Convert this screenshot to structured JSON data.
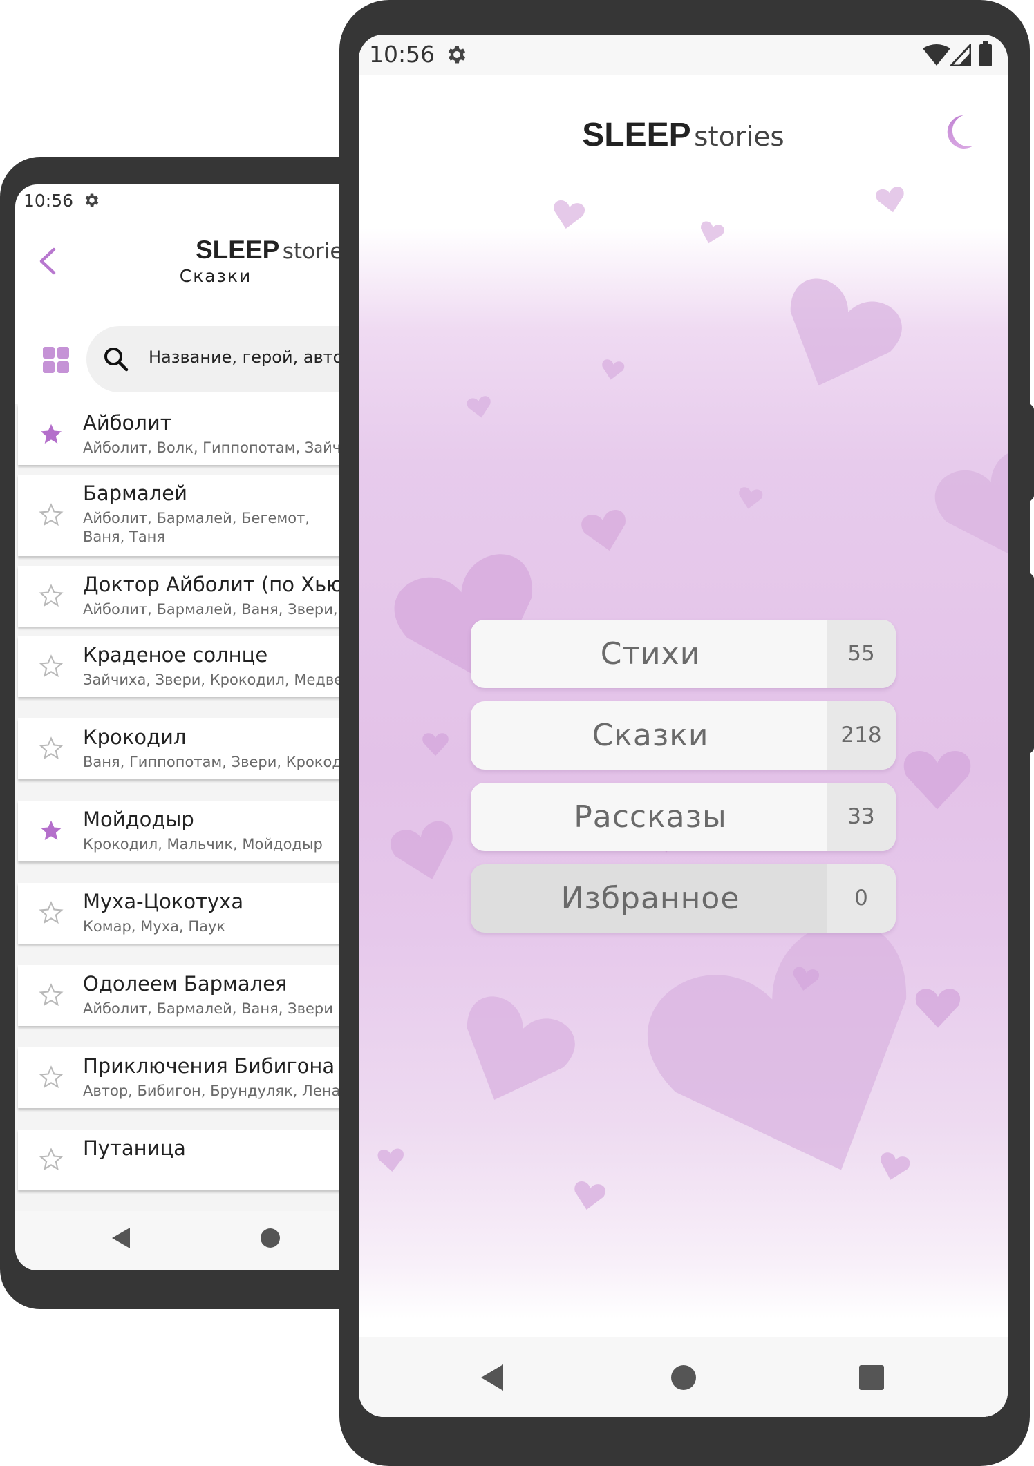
{
  "back_phone": {
    "status": {
      "time": "10:56",
      "settings_icon": "gear-icon"
    },
    "header": {
      "brand_bold": "SLEEP",
      "brand_light": "stories",
      "subtitle": "Сказки"
    },
    "search": {
      "placeholder": "Название, герой, автор"
    },
    "items": [
      {
        "title": "Айболит",
        "subtitle": "Айболит, Волк, Гиппопотам, Зайчиха",
        "favorite": true
      },
      {
        "title": "Бармалей",
        "subtitle": "Айболит, Бармалей, Бегемот, Ваня, Таня",
        "favorite": false
      },
      {
        "title": "Доктор Айболит (по Хью Лофтингу)",
        "subtitle": "Айболит, Бармалей, Ваня, Звери, Пираты",
        "favorite": false
      },
      {
        "title": "Краденое солнце",
        "subtitle": "Зайчиха, Звери, Крокодил, Медведь",
        "favorite": false
      },
      {
        "title": "Крокодил",
        "subtitle": "Ваня, Гиппопотам, Звери, Крокодил",
        "favorite": false
      },
      {
        "title": "Мойдодыр",
        "subtitle": "Крокодил, Мальчик, Мойдодыр",
        "favorite": true
      },
      {
        "title": "Муха-Цокотуха",
        "subtitle": "Комар, Муха, Паук",
        "favorite": false
      },
      {
        "title": "Одолеем Бармалея",
        "subtitle": "Айболит, Бармалей, Ваня, Звери",
        "favorite": false
      },
      {
        "title": "Приключения Бибигона",
        "subtitle": "Автор, Бибигон, Брундуляк, Лена, Таня",
        "favorite": false
      },
      {
        "title": "Путаница",
        "subtitle": "",
        "favorite": false
      }
    ]
  },
  "front_phone": {
    "status": {
      "time": "10:56",
      "settings_icon": "gear-icon"
    },
    "header": {
      "brand_bold": "SLEEP",
      "brand_light": "stories",
      "theme_icon": "moon-icon"
    },
    "menu": [
      {
        "label": "Стихи",
        "count": "55",
        "kind": "normal"
      },
      {
        "label": "Сказки",
        "count": "218",
        "kind": "normal"
      },
      {
        "label": "Рассказы",
        "count": "33",
        "kind": "normal"
      },
      {
        "label": "Избранное",
        "count": "0",
        "kind": "disabled"
      }
    ]
  },
  "colors": {
    "accent": "#b878cf",
    "frame": "#363636",
    "background_tint": "#e3c2e8"
  }
}
